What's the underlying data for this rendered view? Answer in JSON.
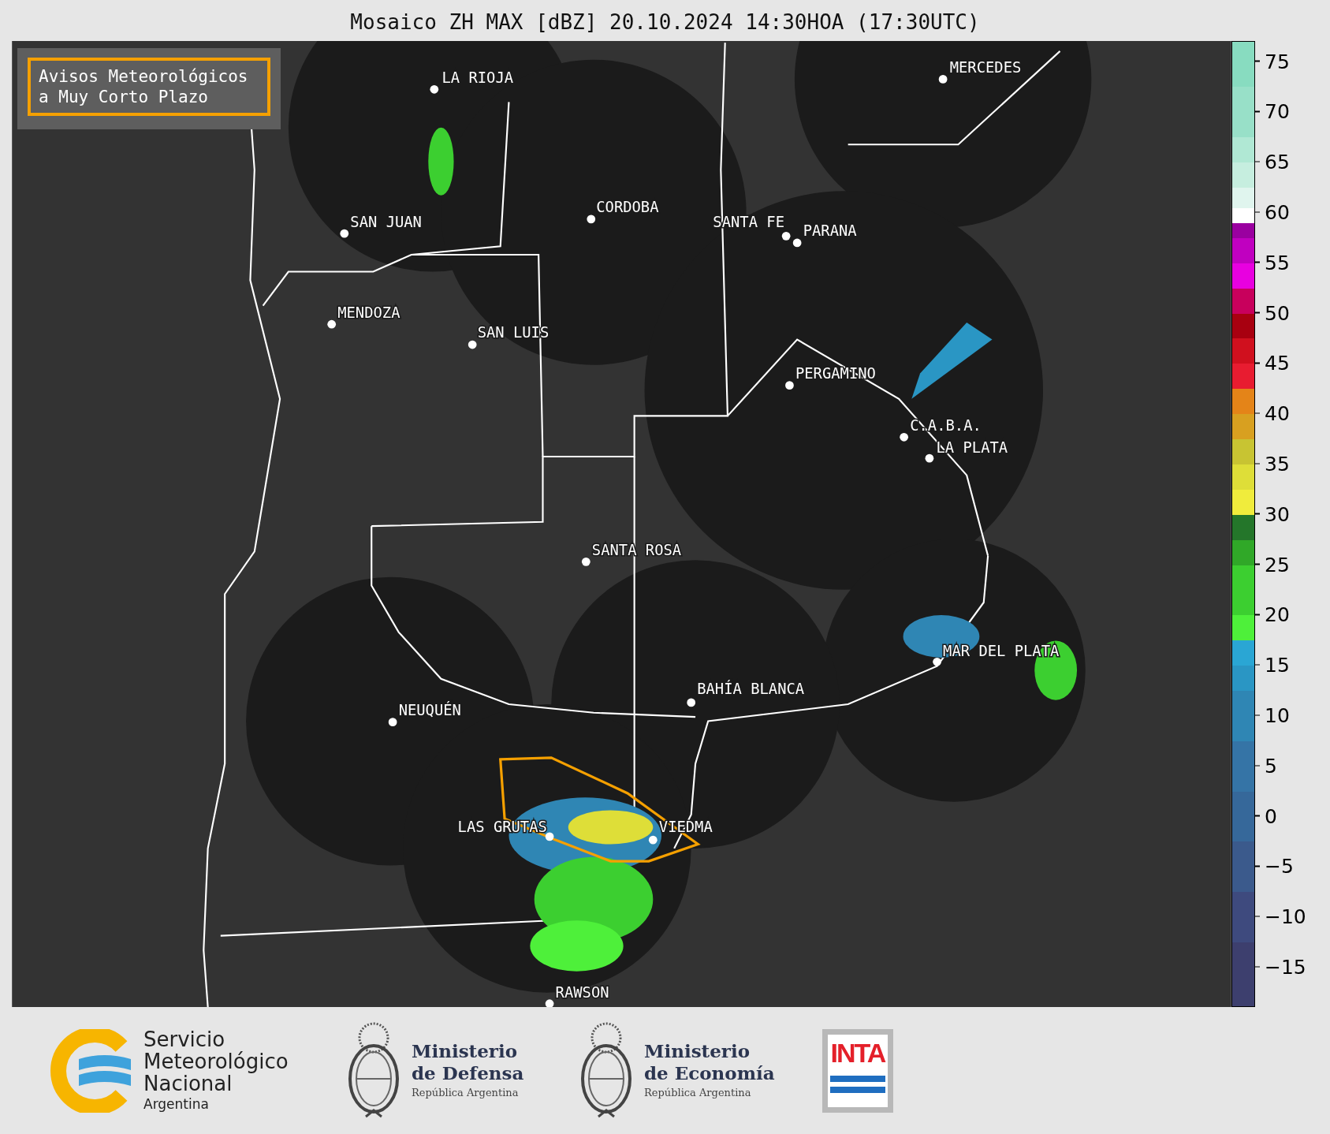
{
  "title": "Mosaico ZH MAX [dBZ] 20.10.2024 14:30HOA (17:30UTC)",
  "warning_legend": {
    "lines": [
      "Avisos Meteorológicos",
      "a Muy Corto Plazo"
    ]
  },
  "cities": [
    "LA RIOJA",
    "CORDOBA",
    "SAN JUAN",
    "SANTA FE",
    "PARANA",
    "MENDOZA",
    "SAN LUIS",
    "MERCEDES",
    "PERGAMINO",
    "C.A.B.A.",
    "LA PLATA",
    "SANTA ROSA",
    "MAR DEL PLATA",
    "BAHÍA BLANCA",
    "NEUQUÉN",
    "LAS GRUTAS",
    "VIEDMA",
    "RAWSON"
  ],
  "colorbar": {
    "ticks": [
      "75",
      "70",
      "65",
      "60",
      "55",
      "50",
      "45",
      "40",
      "35",
      "30",
      "25",
      "20",
      "15",
      "10",
      "5",
      "0",
      "−5",
      "−10",
      "−15"
    ]
  },
  "footer": {
    "logos": [
      {
        "kind": "smn",
        "lines": [
          "Servicio",
          "Meteorológico",
          "Nacional"
        ],
        "subtitle": "Argentina"
      },
      {
        "kind": "ministry",
        "lines": [
          "Ministerio",
          "de Defensa"
        ],
        "subtitle": "República Argentina"
      },
      {
        "kind": "ministry",
        "lines": [
          "Ministerio",
          "de Economía"
        ],
        "subtitle": "República Argentina"
      },
      {
        "kind": "inta",
        "lines": [
          "INTA"
        ]
      }
    ]
  }
}
